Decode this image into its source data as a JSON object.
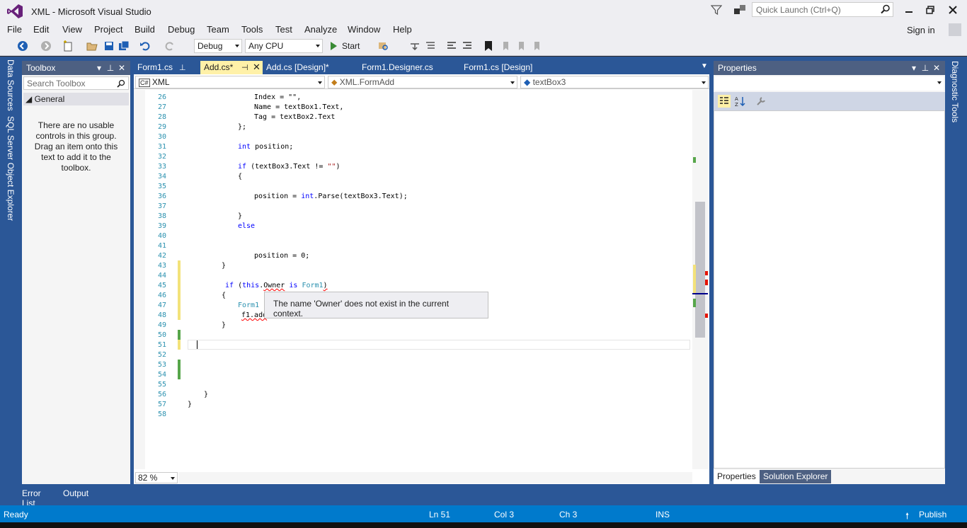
{
  "window": {
    "title": "XML - Microsoft Visual Studio",
    "quick_launch_placeholder": "Quick Launch (Ctrl+Q)",
    "sign_in": "Sign in"
  },
  "menu": [
    "File",
    "Edit",
    "View",
    "Project",
    "Build",
    "Debug",
    "Team",
    "Tools",
    "Test",
    "Analyze",
    "Window",
    "Help"
  ],
  "toolbar": {
    "config": "Debug",
    "platform": "Any CPU",
    "start": "Start"
  },
  "side_tabs": {
    "data_sources": "Data Sources",
    "sql_explorer": "SQL Server Object Explorer",
    "diagnostic": "Diagnostic Tools"
  },
  "toolbox": {
    "title": "Toolbox",
    "search_placeholder": "Search Toolbox",
    "group": "General",
    "empty_message": "There are no usable controls in this group. Drag an item onto this text to add it to the toolbox."
  },
  "tabs": [
    {
      "label": "Form1.cs"
    },
    {
      "label": "Add.cs*"
    },
    {
      "label": "Add.cs [Design]*"
    },
    {
      "label": "Form1.Designer.cs"
    },
    {
      "label": "Form1.cs [Design]"
    }
  ],
  "nav": {
    "project": "XML",
    "class": "XML.FormAdd",
    "member": "textBox3"
  },
  "code": {
    "line_numbers": [
      "26",
      "27",
      "28",
      "29",
      "30",
      "31",
      "32",
      "33",
      "34",
      "35",
      "36",
      "37",
      "38",
      "39",
      "40",
      "41",
      "42",
      "43",
      "44",
      "45",
      "46",
      "47",
      "48",
      "49",
      "50",
      "51",
      "52",
      "53",
      "54",
      "55",
      "56",
      "57",
      "58"
    ],
    "l26": "Index = \"\",",
    "l27": "Name = textBox1.Text,",
    "l28": "Tag = textBox2.Text",
    "l29": "};",
    "l31_kw": "int",
    "l31_rest": " position;",
    "l33_kw": "if",
    "l33_a": " (textBox3.Text != ",
    "l33_str": "\"\"",
    "l33_b": ")",
    "l34": "{",
    "l36_a": "position = ",
    "l36_kw": "int",
    "l36_b": ".Parse(textBox3.Text);",
    "l38": "}",
    "l39": "else",
    "l42": "position = 0;",
    "l43": "}",
    "l45_kw1": "if",
    "l45_a": " (",
    "l45_kw2": "this",
    "l45_b": ".",
    "l45_owner": "Owner",
    "l45_c": " ",
    "l45_kw3": "is",
    "l45_d": " ",
    "l45_type": "Form1",
    "l45_e": ")",
    "l46": "{",
    "l47_type": "Form1",
    "l47_rest": " ",
    "l48": "f1.add",
    "l49": "}",
    "l56": "}",
    "l57": "}"
  },
  "tooltip": "The name 'Owner' does not exist in the current context.",
  "zoom": "82 %",
  "properties": {
    "title": "Properties",
    "tab_properties": "Properties",
    "tab_solution": "Solution Explorer"
  },
  "bottom_tabs": {
    "error_list": "Error List",
    "output": "Output"
  },
  "status": {
    "state": "Ready",
    "line": "Ln 51",
    "col": "Col 3",
    "ch": "Ch 3",
    "mode": "INS",
    "publish": "Publish"
  },
  "colors": {
    "accent": "#007acc",
    "chrome": "#eeeef2",
    "active_tab": "#fff1a8",
    "panel_header": "#4d6082",
    "dock_bg": "#2b5797"
  }
}
